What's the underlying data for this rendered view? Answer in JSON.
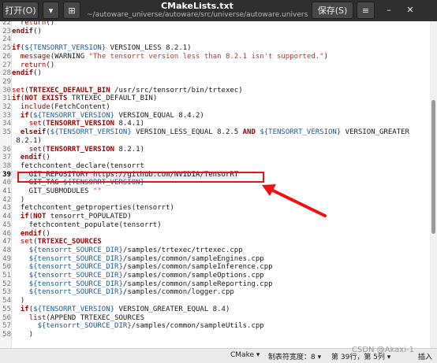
{
  "window": {
    "title": "CMakeLists.txt",
    "path": "~/autoware_universe/autoware/src/universe/autoware.universe/common/tr...",
    "open_label": "打开(O)",
    "save_label": "保存(S)"
  },
  "code": [
    {
      "n": "22",
      "t": [
        [
          "  "
        ],
        [
          "return",
          "fn"
        ],
        [
          "()"
        ]
      ]
    },
    {
      "n": "23",
      "t": [
        [
          "endif",
          "kw"
        ],
        [
          "()"
        ]
      ]
    },
    {
      "n": "24",
      "t": [
        [
          ""
        ]
      ]
    },
    {
      "n": "25",
      "t": [
        [
          "if",
          "kw"
        ],
        [
          "("
        ],
        [
          "${TENSORRT_VERSION}",
          "var"
        ],
        [
          " VERSION_LESS 8.2.1)"
        ]
      ]
    },
    {
      "n": "26",
      "t": [
        [
          "  "
        ],
        [
          "message",
          "fn"
        ],
        [
          "(WARNING "
        ],
        [
          "\"The tensorrt version less than 8.2.1 isn't supported.\"",
          "str"
        ],
        [
          ")"
        ]
      ]
    },
    {
      "n": "27",
      "t": [
        [
          "  "
        ],
        [
          "return",
          "fn"
        ],
        [
          "()"
        ]
      ]
    },
    {
      "n": "28",
      "t": [
        [
          "endif",
          "kw"
        ],
        [
          "()"
        ]
      ]
    },
    {
      "n": "29",
      "t": [
        [
          ""
        ]
      ]
    },
    {
      "n": "30",
      "t": [
        [
          "set",
          "fn"
        ],
        [
          "("
        ],
        [
          "TRTEXEC_DEFAULT_BIN",
          "kw"
        ],
        [
          " /usr/src/tensorrt/bin/trtexec)"
        ]
      ]
    },
    {
      "n": "31",
      "t": [
        [
          "if",
          "kw"
        ],
        [
          "("
        ],
        [
          "NOT EXISTS",
          "kw"
        ],
        [
          " TRTEXEC_DEFAULT_BIN)"
        ]
      ]
    },
    {
      "n": "32",
      "t": [
        [
          "  "
        ],
        [
          "include",
          "fn"
        ],
        [
          "(FetchContent)"
        ]
      ]
    },
    {
      "n": "33",
      "t": [
        [
          "  "
        ],
        [
          "if",
          "kw"
        ],
        [
          "("
        ],
        [
          "${TENSORRT_VERSION}",
          "var"
        ],
        [
          " VERSION_EQUAL 8.4.2)"
        ]
      ]
    },
    {
      "n": "34",
      "t": [
        [
          "    "
        ],
        [
          "set",
          "fn"
        ],
        [
          "("
        ],
        [
          "TENSORRT_VERSION",
          "kw"
        ],
        [
          " 8.4.1)"
        ]
      ]
    },
    {
      "n": "35",
      "t": [
        [
          "  "
        ],
        [
          "elseif",
          "kw"
        ],
        [
          "("
        ],
        [
          "${TENSORRT_VERSION}",
          "var"
        ],
        [
          " VERSION_LESS_EQUAL 8.2.5 "
        ],
        [
          "AND",
          "kw"
        ],
        [
          " "
        ],
        [
          "${TENSORRT_VERSION}",
          "var"
        ],
        [
          " VERSION_GREATER"
        ]
      ]
    },
    {
      "n": "",
      "t": [
        [
          " 8.2.1)"
        ]
      ]
    },
    {
      "n": "36",
      "t": [
        [
          "    "
        ],
        [
          "set",
          "fn"
        ],
        [
          "("
        ],
        [
          "TENSORRT_VERSION",
          "kw"
        ],
        [
          " 8.2.1)"
        ]
      ]
    },
    {
      "n": "37",
      "t": [
        [
          "  "
        ],
        [
          "endif",
          "kw"
        ],
        [
          "()"
        ]
      ]
    },
    {
      "n": "38",
      "t": [
        [
          "  fetchcontent_declare(tensorrt"
        ]
      ]
    },
    {
      "n": "39",
      "t": [
        [
          "    GIT_REPOSITORY https://github.com/NVIDIA/TensorRT"
        ]
      ],
      "current": true
    },
    {
      "n": "40",
      "t": [
        [
          "    GIT_TAG "
        ],
        [
          "${TENSORRT_VERSION}",
          "var"
        ]
      ]
    },
    {
      "n": "41",
      "t": [
        [
          "    GIT_SUBMODULES "
        ],
        [
          "\"\"",
          "str"
        ]
      ]
    },
    {
      "n": "42",
      "t": [
        [
          "  )"
        ]
      ]
    },
    {
      "n": "43",
      "t": [
        [
          "  fetchcontent_getproperties(tensorrt)"
        ]
      ]
    },
    {
      "n": "44",
      "t": [
        [
          "  "
        ],
        [
          "if",
          "kw"
        ],
        [
          "("
        ],
        [
          "NOT",
          "kw"
        ],
        [
          " tensorrt_POPULATED)"
        ]
      ]
    },
    {
      "n": "45",
      "t": [
        [
          "    fetchcontent_populate(tensorrt)"
        ]
      ]
    },
    {
      "n": "46",
      "t": [
        [
          "  "
        ],
        [
          "endif",
          "kw"
        ],
        [
          "()"
        ]
      ]
    },
    {
      "n": "47",
      "t": [
        [
          "  "
        ],
        [
          "set",
          "fn"
        ],
        [
          "("
        ],
        [
          "TRTEXEC_SOURCES",
          "kw"
        ]
      ]
    },
    {
      "n": "48",
      "t": [
        [
          "    "
        ],
        [
          "${tensorrt_SOURCE_DIR}",
          "var"
        ],
        [
          "/samples/trtexec/trtexec.cpp"
        ]
      ]
    },
    {
      "n": "49",
      "t": [
        [
          "    "
        ],
        [
          "${tensorrt_SOURCE_DIR}",
          "var"
        ],
        [
          "/samples/common/sampleEngines.cpp"
        ]
      ]
    },
    {
      "n": "50",
      "t": [
        [
          "    "
        ],
        [
          "${tensorrt_SOURCE_DIR}",
          "var"
        ],
        [
          "/samples/common/sampleInference.cpp"
        ]
      ]
    },
    {
      "n": "51",
      "t": [
        [
          "    "
        ],
        [
          "${tensorrt_SOURCE_DIR}",
          "var"
        ],
        [
          "/samples/common/sampleOptions.cpp"
        ]
      ]
    },
    {
      "n": "52",
      "t": [
        [
          "    "
        ],
        [
          "${tensorrt_SOURCE_DIR}",
          "var"
        ],
        [
          "/samples/common/sampleReporting.cpp"
        ]
      ]
    },
    {
      "n": "53",
      "t": [
        [
          "    "
        ],
        [
          "${tensorrt_SOURCE_DIR}",
          "var"
        ],
        [
          "/samples/common/logger.cpp"
        ]
      ]
    },
    {
      "n": "54",
      "t": [
        [
          "  )"
        ]
      ]
    },
    {
      "n": "55",
      "t": [
        [
          "  "
        ],
        [
          "if",
          "kw"
        ],
        [
          "("
        ],
        [
          "${TENSORRT_VERSION}",
          "var"
        ],
        [
          " VERSION_GREATER_EQUAL 8.4)"
        ]
      ]
    },
    {
      "n": "56",
      "t": [
        [
          "    "
        ],
        [
          "list",
          "fn"
        ],
        [
          "(APPEND TRTEXEC_SOURCES"
        ]
      ]
    },
    {
      "n": "57",
      "t": [
        [
          "      "
        ],
        [
          "${tensorrt_SOURCE_DIR}",
          "var"
        ],
        [
          "/samples/common/sampleUtils.cpp"
        ]
      ]
    },
    {
      "n": "58",
      "t": [
        [
          "    )"
        ]
      ]
    }
  ],
  "status": {
    "language": "CMake",
    "tab_width": "制表符宽度：8",
    "position": "第 39行，第 5列",
    "mode": "插入"
  },
  "watermark": "CSDN @Akaxi-1",
  "colors": {
    "highlight_box": "#ee1111",
    "arrow": "#ee1111",
    "header": "#2f2f2f"
  }
}
